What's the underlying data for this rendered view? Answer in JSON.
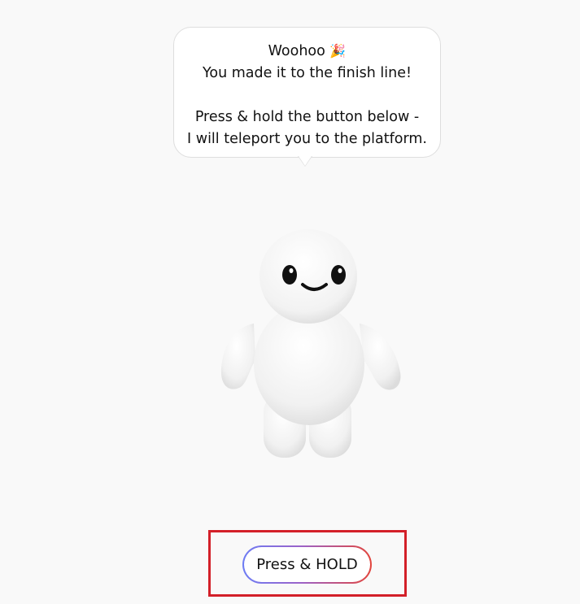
{
  "bubble": {
    "title": "Woohoo",
    "title_emoji": "🎉",
    "line1": "You made it to the finish line!",
    "line2": "Press & hold the button below -",
    "line3": "I will teleport you to the platform."
  },
  "mascot": {
    "icon": "white-mascot-figure"
  },
  "action": {
    "button_label": "Press & HOLD"
  },
  "colors": {
    "highlight": "#d32029",
    "gradient_start": "#6d7cf4",
    "gradient_end": "#e2453d"
  }
}
